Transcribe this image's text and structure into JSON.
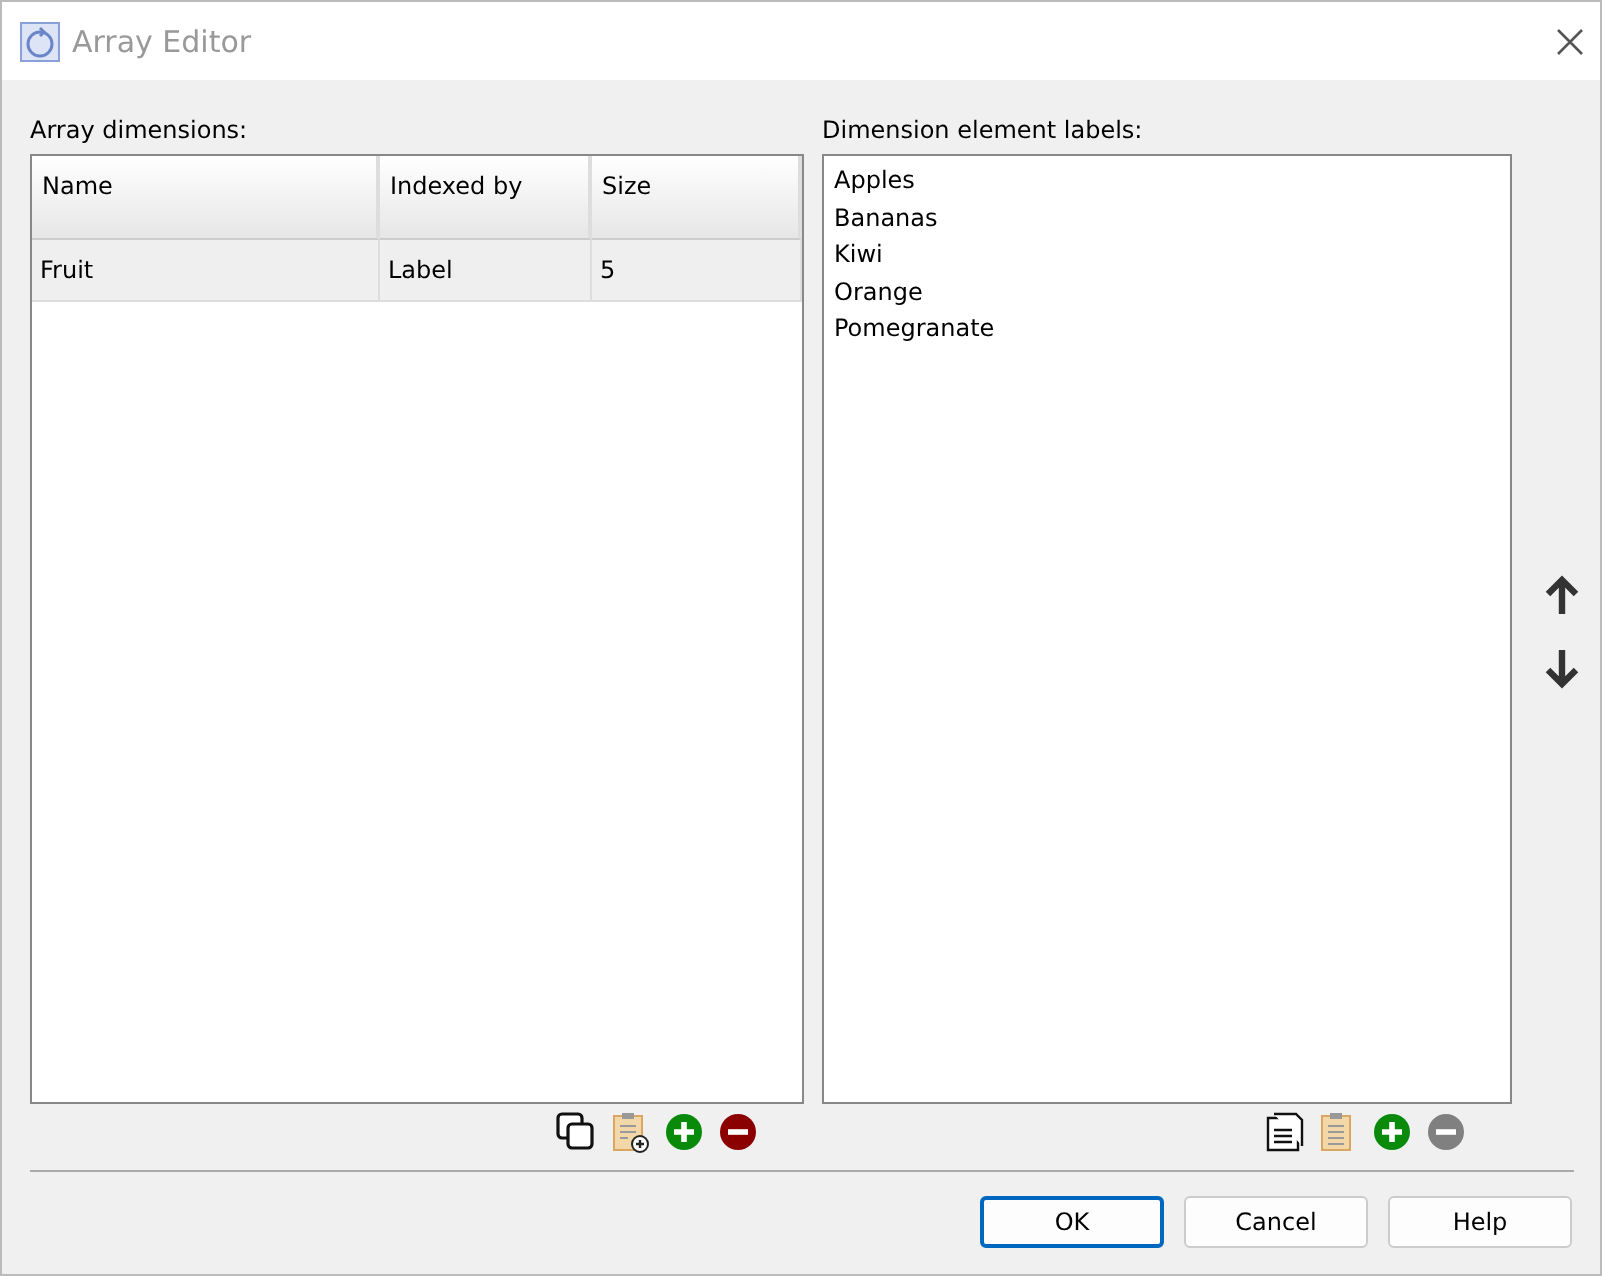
{
  "window": {
    "title": "Array Editor"
  },
  "dimensions": {
    "label": "Array dimensions:",
    "columns": [
      "Name",
      "Indexed by",
      "Size"
    ],
    "rows": [
      {
        "cells": [
          "Fruit",
          "Label",
          "5"
        ],
        "selected": false
      }
    ],
    "tools": [
      {
        "kind": "copy",
        "disabled": false
      },
      {
        "kind": "paste-add",
        "disabled": false
      },
      {
        "kind": "add",
        "disabled": false
      },
      {
        "kind": "remove",
        "disabled": false
      }
    ]
  },
  "labels": {
    "label": "Dimension element labels:",
    "items": [
      "Apples",
      "Bananas",
      "Kiwi",
      "Orange",
      "Pomegranate"
    ],
    "tools": [
      {
        "kind": "document",
        "disabled": false
      },
      {
        "kind": "paste",
        "disabled": false
      },
      {
        "kind": "add",
        "disabled": false
      },
      {
        "kind": "remove",
        "disabled": true
      }
    ]
  },
  "buttons": [
    {
      "label": "OK",
      "default": true
    },
    {
      "label": "Cancel",
      "default": false
    },
    {
      "label": "Help",
      "default": false
    }
  ]
}
